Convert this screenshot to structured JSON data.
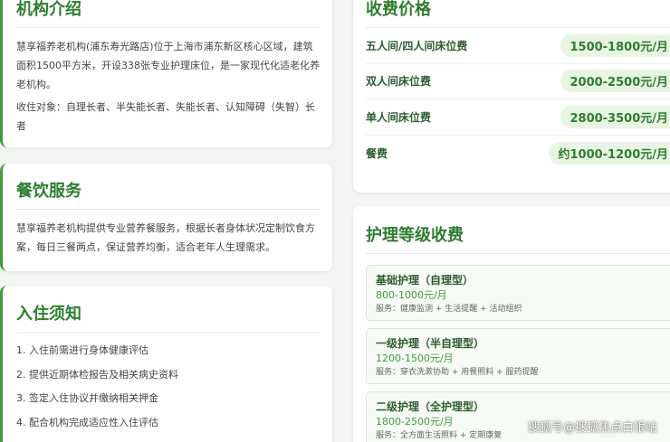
{
  "intro": {
    "title": "机构介绍",
    "desc": "慧享福养老机构(浦东寿光路店)位于上海市浦东新区核心区域，建筑面积1500平方米，开设338张专业护理床位，是一家现代化适老化养老机构。",
    "targets": "收住对象：自理长者、半失能长者、失能长者、认知障碍（失智）长者"
  },
  "food": {
    "title": "餐饮服务",
    "desc": "慧享福养老机构提供专业营养餐服务，根据长者身体状况定制饮食方案，每日三餐两点，保证营养均衡，适合老年人生理需求。"
  },
  "checkin": {
    "title": "入住须知",
    "steps": [
      "1. 入住前需进行身体健康评估",
      "2. 提供近期体检报告及相关病史资料",
      "3. 签定入住协议并缴纳相关押金",
      "4. 配合机构完成适应性入住评估"
    ]
  },
  "pricing": {
    "title": "收费价格",
    "rows": [
      {
        "name": "五人间/四人间床位费",
        "price": "1500-1800元/月"
      },
      {
        "name": "双人间床位费",
        "price": "2000-2500元/月"
      },
      {
        "name": "单人间床位费",
        "price": "2800-3500元/月"
      },
      {
        "name": "餐费",
        "price": "约1000-1200元/月"
      }
    ]
  },
  "care": {
    "title": "护理等级收费",
    "levels": [
      {
        "title": "基础护理（自理型）",
        "price": "800-1000元/月",
        "service": "服务：健康监测 + 生活提醒 + 活动组织"
      },
      {
        "title": "一级护理（半自理型）",
        "price": "1200-1500元/月",
        "service": "服务：穿衣洗漱协助 + 用餐照料 + 服药提醒"
      },
      {
        "title": "二级护理（全护理型）",
        "price": "1800-2500元/月",
        "service": "服务：全方面生活照料 + 定期康复"
      }
    ]
  },
  "watermark": "搜狐号@搜狐焦点白银站",
  "colors": {
    "accent": "#2e7d32",
    "accent_bg": "#e8f5e3",
    "border": "#3f9a3b"
  }
}
